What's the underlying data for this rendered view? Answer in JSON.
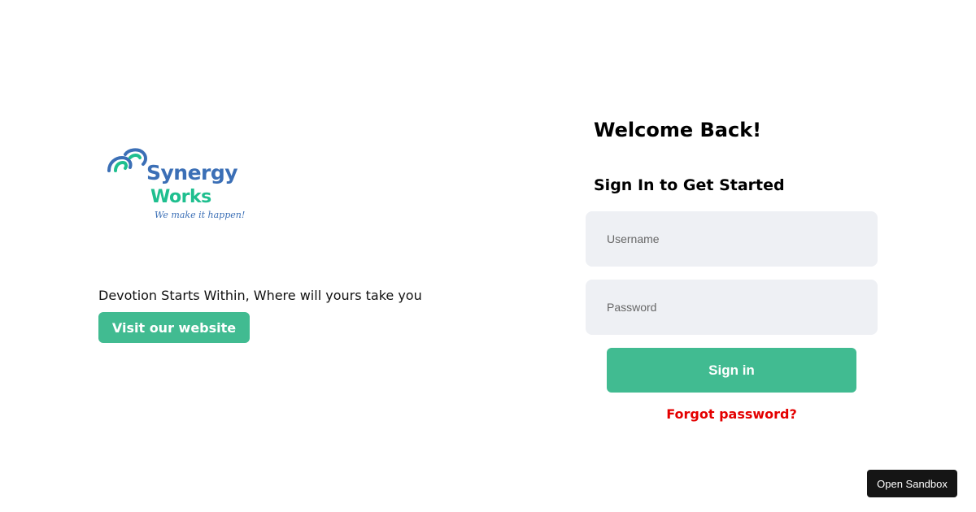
{
  "brand": {
    "name_line1": "Synergy",
    "name_line2": "Works",
    "tagline": "We make it happen!",
    "icon": "wave-swirl-logo-icon",
    "colors": {
      "blue": "#3b6fb6",
      "green": "#1fbf8f"
    }
  },
  "left": {
    "tagline": "Devotion Starts Within, Where will yours take you",
    "visit_label": "Visit our website"
  },
  "login": {
    "welcome": "Welcome Back!",
    "subtitle": "Sign In to Get Started",
    "username_placeholder": "Username",
    "password_placeholder": "Password",
    "signin_label": "Sign in",
    "forgot_label": "Forgot password?"
  },
  "sandbox": {
    "label": "Open Sandbox"
  },
  "colors": {
    "accent": "#41bb91",
    "input_bg": "#eef0f4",
    "forgot": "#e40000",
    "sandbox_bg": "#151515"
  }
}
